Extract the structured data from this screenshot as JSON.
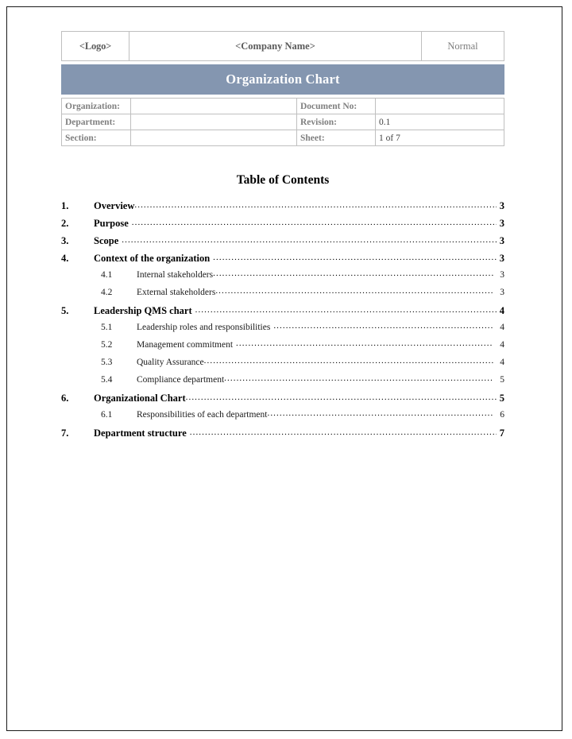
{
  "header": {
    "logo_placeholder": "<Logo>",
    "company_placeholder": "<Company Name>",
    "status": "Normal",
    "banner_title": "Organization Chart",
    "banner_color": "#8496b0"
  },
  "metadata": {
    "rows": [
      {
        "label": "Organization:",
        "value": "",
        "label2": "Document No:",
        "value2": ""
      },
      {
        "label": "Department:",
        "value": "",
        "label2": "Revision:",
        "value2": "0.1"
      },
      {
        "label": "Section:",
        "value": "",
        "label2": "Sheet:",
        "value2": "1 of 7"
      }
    ]
  },
  "toc": {
    "title": "Table of Contents",
    "entries": [
      {
        "level": 1,
        "number": "1.",
        "label": "Overview",
        "page": "3",
        "gap": 0
      },
      {
        "level": 1,
        "number": "2.",
        "label": "Purpose",
        "page": "3",
        "gap": 1
      },
      {
        "level": 1,
        "number": "3.",
        "label": "Scope",
        "page": "3",
        "gap": 1
      },
      {
        "level": 1,
        "number": "4.",
        "label": "Context of the organization",
        "page": "3",
        "gap": 1
      },
      {
        "level": 2,
        "number": "4.1",
        "label": "Internal stakeholders",
        "page": "3",
        "gap": 0
      },
      {
        "level": 2,
        "number": "4.2",
        "label": "External stakeholders",
        "page": "3",
        "gap": 0
      },
      {
        "level": 1,
        "number": "5.",
        "label": "Leadership QMS chart",
        "page": "4",
        "gap": 1
      },
      {
        "level": 2,
        "number": "5.1",
        "label": "Leadership roles and responsibilities",
        "page": "4",
        "gap": 1
      },
      {
        "level": 2,
        "number": "5.2",
        "label": "Management commitment",
        "page": "4",
        "gap": 1
      },
      {
        "level": 2,
        "number": "5.3",
        "label": "Quality Assurance",
        "page": "4",
        "gap": 0
      },
      {
        "level": 2,
        "number": "5.4",
        "label": "Compliance department",
        "page": "5",
        "gap": 0
      },
      {
        "level": 1,
        "number": "6.",
        "label": "Organizational Chart",
        "page": "5",
        "gap": 0
      },
      {
        "level": 2,
        "number": "6.1",
        "label": "Responsibilities of each department",
        "page": "6",
        "gap": 0
      },
      {
        "level": 1,
        "number": "7.",
        "label": "Department structure",
        "page": "7",
        "gap": 1
      }
    ]
  }
}
